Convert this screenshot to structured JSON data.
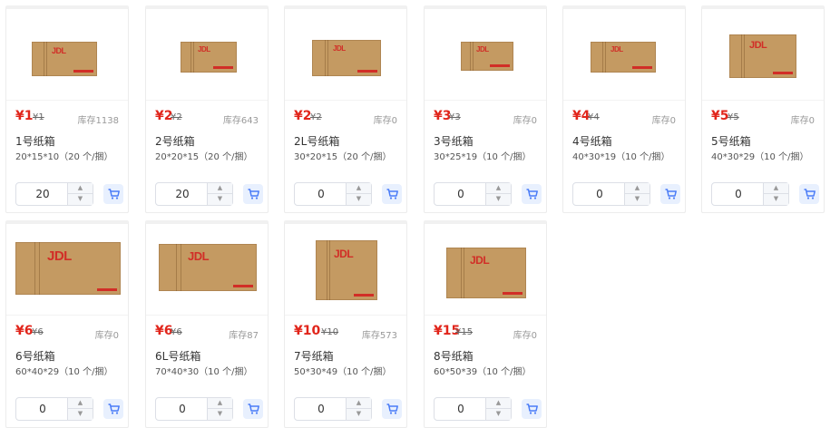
{
  "products": [
    {
      "price": "¥1",
      "orig": "¥1",
      "stock": "库存1138",
      "name": "1号纸箱",
      "spec": "20*15*10（20 个/捆）",
      "qty": "20"
    },
    {
      "price": "¥2",
      "orig": "¥2",
      "stock": "库存643",
      "name": "2号纸箱",
      "spec": "20*20*15（20 个/捆）",
      "qty": "20"
    },
    {
      "price": "¥2",
      "orig": "¥2",
      "stock": "库存0",
      "name": "2L号纸箱",
      "spec": "30*20*15（20 个/捆）",
      "qty": "0"
    },
    {
      "price": "¥3",
      "orig": "¥3",
      "stock": "库存0",
      "name": "3号纸箱",
      "spec": "30*25*19（10 个/捆）",
      "qty": "0"
    },
    {
      "price": "¥4",
      "orig": "¥4",
      "stock": "库存0",
      "name": "4号纸箱",
      "spec": "40*30*19（10 个/捆）",
      "qty": "0"
    },
    {
      "price": "¥5",
      "orig": "¥5",
      "stock": "库存0",
      "name": "5号纸箱",
      "spec": "40*30*29（10 个/捆）",
      "qty": "0"
    },
    {
      "price": "¥6",
      "orig": "¥6",
      "stock": "库存0",
      "name": "6号纸箱",
      "spec": "60*40*29（10 个/捆）",
      "qty": "0"
    },
    {
      "price": "¥6",
      "orig": "¥6",
      "stock": "库存87",
      "name": "6L号纸箱",
      "spec": "70*40*30（10 个/捆）",
      "qty": "0"
    },
    {
      "price": "¥10",
      "orig": "¥10",
      "stock": "库存573",
      "name": "7号纸箱",
      "spec": "50*30*49（10 个/捆）",
      "qty": "0"
    },
    {
      "price": "¥15",
      "orig": "¥15",
      "stock": "库存0",
      "name": "8号纸箱",
      "spec": "60*50*39（10 个/捆）",
      "qty": "0"
    }
  ],
  "box_logo": "JDL 京东快递",
  "colors": {
    "price_red": "#e1251b",
    "cart_blue": "#4a7cf7",
    "box_tan": "#c49a62"
  },
  "icons": {
    "cart": "cart-icon",
    "up": "chevron-up-icon",
    "down": "chevron-down-icon"
  }
}
